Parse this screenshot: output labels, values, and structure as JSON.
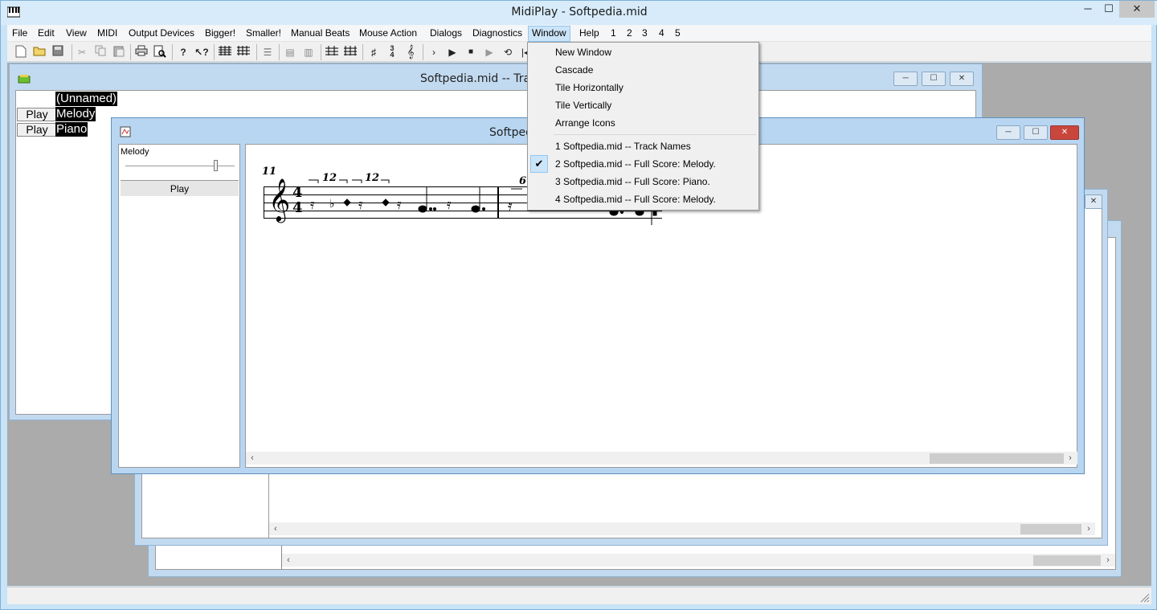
{
  "app": {
    "title": "MidiPlay - Softpedia.mid",
    "window_controls": {
      "minimize": "─",
      "maximize": "☐",
      "close": "✕"
    }
  },
  "menubar": [
    {
      "label": "File"
    },
    {
      "label": "Edit"
    },
    {
      "label": "View"
    },
    {
      "label": "MIDI"
    },
    {
      "label": "Output Devices"
    },
    {
      "label": "Bigger!"
    },
    {
      "label": "Smaller!"
    },
    {
      "label": "Manual Beats"
    },
    {
      "label": "Mouse Action"
    },
    {
      "label": "Dialogs"
    },
    {
      "label": "Diagnostics"
    },
    {
      "label": "Window"
    },
    {
      "label": "Help"
    },
    {
      "label": "1"
    },
    {
      "label": "2"
    },
    {
      "label": "3"
    },
    {
      "label": "4"
    },
    {
      "label": "5"
    }
  ],
  "window_menu": {
    "items": [
      "New Window",
      "Cascade",
      "Tile Horizontally",
      "Tile Vertically",
      "Arrange Icons"
    ],
    "windows": [
      "1 Softpedia.mid -- Track Names",
      "2 Softpedia.mid -- Full Score: Melody.",
      "3 Softpedia.mid -- Full Score: Piano.",
      "4 Softpedia.mid -- Full Score: Melody."
    ],
    "check": "✔"
  },
  "track_window": {
    "title": "Softpedia.mid -- Track Nam",
    "header": "(Unnamed)",
    "tracks": [
      {
        "button": "Play",
        "name": "Melody"
      },
      {
        "button": "Play",
        "name": "Piano"
      }
    ]
  },
  "score_window": {
    "title": "Softpedia.m",
    "panel_label": "Melody",
    "play_button": "Play",
    "measure_number": "11",
    "time_sig_top": "4",
    "time_sig_bottom": "4",
    "tuplet_1": "12",
    "tuplet_2": "12",
    "tuplet_3": "6"
  },
  "colors": {
    "frame": "#c9e3f7",
    "child_frame": "#c2daf0",
    "mdi_background": "#ababab",
    "close_button": "#c9463d",
    "menu_highlight": "#cce4f7"
  }
}
